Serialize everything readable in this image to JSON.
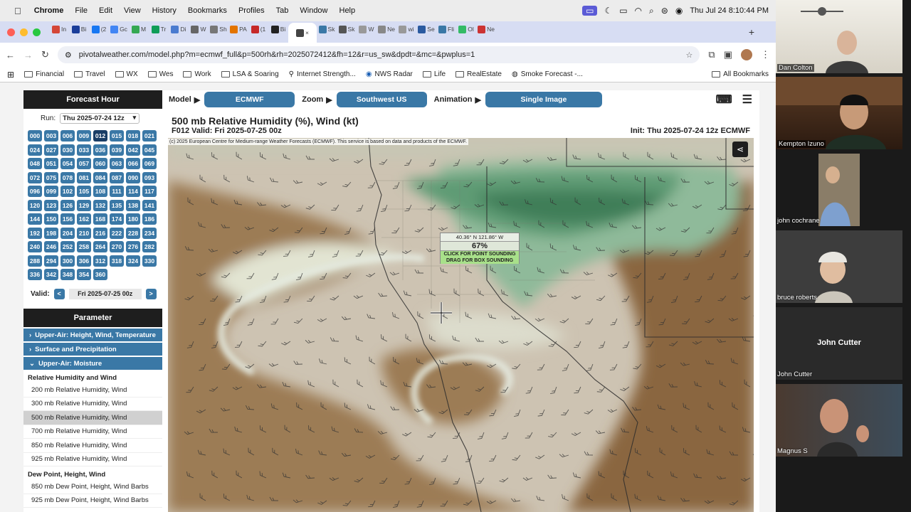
{
  "menubar": {
    "app": "Chrome",
    "items": [
      "File",
      "Edit",
      "View",
      "History",
      "Bookmarks",
      "Profiles",
      "Tab",
      "Window",
      "Help"
    ],
    "clock": "Thu Jul 24  8:10:44 PM"
  },
  "tabs": [
    {
      "label": "In",
      "color": "#d44638"
    },
    {
      "label": "Bi",
      "color": "#1a3d9a"
    },
    {
      "label": "(2",
      "color": "#1877f2"
    },
    {
      "label": "Gc",
      "color": "#4285f4"
    },
    {
      "label": "M",
      "color": "#34a853"
    },
    {
      "label": "Tr",
      "color": "#0f9d58"
    },
    {
      "label": "Di",
      "color": "#4a7bd0"
    },
    {
      "label": "W",
      "color": "#666"
    },
    {
      "label": "Sh",
      "color": "#777"
    },
    {
      "label": "PA",
      "color": "#e37400"
    },
    {
      "label": "(1",
      "color": "#c62828"
    },
    {
      "label": "Bi",
      "color": "#222"
    },
    {
      "label": "",
      "color": "#444",
      "active": true
    },
    {
      "label": "Sk",
      "color": "#3a78a6"
    },
    {
      "label": "Sk",
      "color": "#555"
    },
    {
      "label": "W",
      "color": "#999"
    },
    {
      "label": "Ne",
      "color": "#888"
    },
    {
      "label": "wi",
      "color": "#999"
    },
    {
      "label": "Se",
      "color": "#2a5aa0"
    },
    {
      "label": "Fli",
      "color": "#3a78a6"
    },
    {
      "label": "Ol",
      "color": "#3b6"
    },
    {
      "label": "Ne",
      "color": "#c33"
    }
  ],
  "address": {
    "url": "pivotalweather.com/model.php?m=ecmwf_full&p=500rh&rh=2025072412&fh=12&r=us_sw&dpdt=&mc=&pwplus=1"
  },
  "bookmarks": {
    "items": [
      "Financial",
      "Travel",
      "WX",
      "Wes",
      "Work",
      "LSA & Soaring",
      "Internet Strength...",
      "NWS Radar",
      "Life",
      "RealEstate",
      "Smoke Forecast -..."
    ],
    "all": "All Bookmarks"
  },
  "sidebar": {
    "forecast_hour_title": "Forecast Hour",
    "run_label": "Run:",
    "run_value": "Thu 2025-07-24 12z",
    "hours": [
      "000",
      "003",
      "006",
      "009",
      "012",
      "015",
      "018",
      "021",
      "024",
      "027",
      "030",
      "033",
      "036",
      "039",
      "042",
      "045",
      "048",
      "051",
      "054",
      "057",
      "060",
      "063",
      "066",
      "069",
      "072",
      "075",
      "078",
      "081",
      "084",
      "087",
      "090",
      "093",
      "096",
      "099",
      "102",
      "105",
      "108",
      "111",
      "114",
      "117",
      "120",
      "123",
      "126",
      "129",
      "132",
      "135",
      "138",
      "141",
      "144",
      "150",
      "156",
      "162",
      "168",
      "174",
      "180",
      "186",
      "192",
      "198",
      "204",
      "210",
      "216",
      "222",
      "228",
      "234",
      "240",
      "246",
      "252",
      "258",
      "264",
      "270",
      "276",
      "282",
      "288",
      "294",
      "300",
      "306",
      "312",
      "318",
      "324",
      "330",
      "336",
      "342",
      "348",
      "354",
      "360"
    ],
    "selected_hour": "012",
    "valid_label": "Valid:",
    "valid_value": "Fri 2025-07-25 00z",
    "parameter_title": "Parameter",
    "categories": [
      "Upper-Air: Height, Wind, Temperature",
      "Surface and Precipitation",
      "Upper-Air: Moisture"
    ],
    "rh_heading": "Relative Humidity and Wind",
    "rh_items": [
      "200 mb Relative Humidity, Wind",
      "300 mb Relative Humidity, Wind",
      "500 mb Relative Humidity, Wind",
      "700 mb Relative Humidity, Wind",
      "850 mb Relative Humidity, Wind",
      "925 mb Relative Humidity, Wind"
    ],
    "selected_item": "500 mb Relative Humidity, Wind",
    "dp_heading": "Dew Point, Height, Wind",
    "dp_items": [
      "850 mb Dew Point, Height, Wind Barbs",
      "925 mb Dew Point, Height, Wind Barbs"
    ]
  },
  "controls": {
    "model_label": "Model",
    "model_value": "ECMWF",
    "zoom_label": "Zoom",
    "zoom_value": "Southwest US",
    "animation_label": "Animation",
    "animation_value": "Single Image"
  },
  "map": {
    "title": "500 mb Relative Humidity (%), Wind (kt)",
    "valid": "F012 Valid: Fri 2025-07-25 00z",
    "init": "Init: Thu 2025-07-24 12z ECMWF",
    "copyright": "(c) 2025 European Centre for Medium-range Weather Forecasts (ECMWF). This service is based on data and products of the ECMWF.",
    "popup_coords": "40.36° N 121.86° W",
    "popup_value": "67%",
    "popup_hint1": "CLICK FOR POINT SOUNDING",
    "popup_hint2": "DRAG FOR BOX SOUNDING"
  },
  "participants": [
    {
      "name": "Dan Colton",
      "boxed": true
    },
    {
      "name": "Kempton Izuno",
      "boxed": true
    },
    {
      "name": "john cochrane",
      "boxed": false
    },
    {
      "name": "bruce roberts",
      "boxed": false
    },
    {
      "name": "John Cutter",
      "boxed": false,
      "no_video": true
    },
    {
      "name": "Magnus S",
      "boxed": false
    }
  ]
}
